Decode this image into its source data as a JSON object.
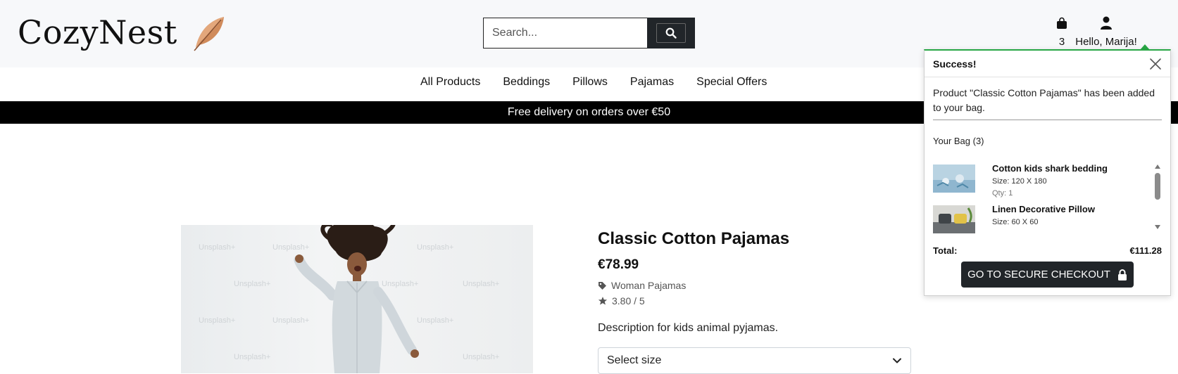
{
  "header": {
    "brand": "CozyNest",
    "search_placeholder": "Search...",
    "bag_count": "3",
    "account_label": "Hello, Marija!"
  },
  "nav": {
    "items": [
      "All Products",
      "Beddings",
      "Pillows",
      "Pajamas",
      "Special Offers"
    ]
  },
  "promo": "Free delivery on orders over €50",
  "product": {
    "watermark": "Unsplash+",
    "title": "Classic Cotton Pajamas",
    "price": "€78.99",
    "category": "Woman Pajamas",
    "rating": "3.80 / 5",
    "description": "Description for kids animal pyjamas.",
    "size_select": "Select size"
  },
  "toast": {
    "title": "Success!",
    "message": "Product \"Classic Cotton Pajamas\" has been added to your bag.",
    "bag_title": "Your Bag (3)",
    "items": [
      {
        "name": "Cotton kids shark bedding",
        "size": "Size: 120 X 180",
        "qty": "Qty: 1"
      },
      {
        "name": "Linen Decorative Pillow",
        "size": "Size: 60 X 60",
        "qty": ""
      }
    ],
    "total_label": "Total:",
    "total_value": "€111.28",
    "checkout_label": "GO TO SECURE CHECKOUT"
  },
  "colors": {
    "header_bg": "#f7f8fa",
    "dark": "#212529",
    "promo_bg": "#000000",
    "success": "#28a745",
    "leaf": "#d08b5b"
  },
  "icons": [
    "feather-icon",
    "search-icon",
    "shopping-bag-icon",
    "user-icon",
    "tag-icon",
    "star-icon",
    "close-icon",
    "lock-icon",
    "chevron-down-icon"
  ]
}
